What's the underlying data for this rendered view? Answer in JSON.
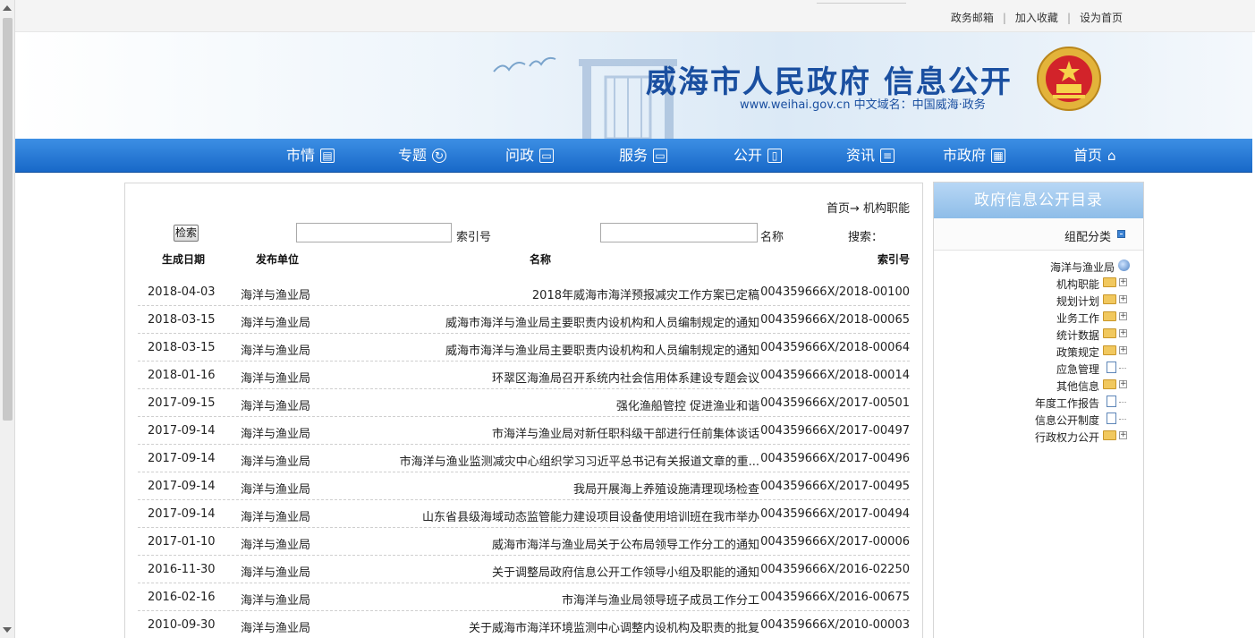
{
  "topbar": {
    "links": [
      "设为首页",
      "加入收藏",
      "政务邮箱"
    ]
  },
  "banner": {
    "title": "威海市人民政府 信息公开",
    "subtitle": "www.weihai.gov.cn 中文域名：中国威海·政务"
  },
  "nav": {
    "items": [
      {
        "label": "首页",
        "icon": "home-icon"
      },
      {
        "label": "市政府",
        "icon": "building-icon"
      },
      {
        "label": "资讯",
        "icon": "news-icon"
      },
      {
        "label": "公开",
        "icon": "book-icon"
      },
      {
        "label": "服务",
        "icon": "monitor-icon"
      },
      {
        "label": "问政",
        "icon": "monitor-icon"
      },
      {
        "label": "专题",
        "icon": "refresh-icon"
      },
      {
        "label": "市情",
        "icon": "document-icon"
      }
    ]
  },
  "main": {
    "breadcrumb": "首页→ 机构职能",
    "search": {
      "label": "搜索：",
      "name_label": "名称",
      "index_label": "索引号",
      "button": "检索"
    },
    "columns": {
      "index": "索引号",
      "name": "名称",
      "unit": "发布单位",
      "date": "生成日期"
    },
    "rows": [
      {
        "index": "004359666X/2018-00100",
        "name": "2018年威海市海洋预报减灾工作方案已定稿",
        "unit": "海洋与渔业局",
        "date": "2018-04-03"
      },
      {
        "index": "004359666X/2018-00065",
        "name": "威海市海洋与渔业局主要职责内设机构和人员编制规定的通知",
        "unit": "海洋与渔业局",
        "date": "2018-03-15"
      },
      {
        "index": "004359666X/2018-00064",
        "name": "威海市海洋与渔业局主要职责内设机构和人员编制规定的通知",
        "unit": "海洋与渔业局",
        "date": "2018-03-15"
      },
      {
        "index": "004359666X/2018-00014",
        "name": "环翠区海渔局召开系统内社会信用体系建设专题会议",
        "unit": "海洋与渔业局",
        "date": "2018-01-16"
      },
      {
        "index": "004359666X/2017-00501",
        "name": "强化渔船管控 促进渔业和谐",
        "unit": "海洋与渔业局",
        "date": "2017-09-15"
      },
      {
        "index": "004359666X/2017-00497",
        "name": "市海洋与渔业局对新任职科级干部进行任前集体谈话",
        "unit": "海洋与渔业局",
        "date": "2017-09-14"
      },
      {
        "index": "004359666X/2017-00496",
        "name": "市海洋与渔业监测减灾中心组织学习习近平总书记有关报道文章的重...",
        "unit": "海洋与渔业局",
        "date": "2017-09-14"
      },
      {
        "index": "004359666X/2017-00495",
        "name": "我局开展海上养殖设施清理现场检查",
        "unit": "海洋与渔业局",
        "date": "2017-09-14"
      },
      {
        "index": "004359666X/2017-00494",
        "name": "山东省县级海域动态监管能力建设项目设备使用培训班在我市举办",
        "unit": "海洋与渔业局",
        "date": "2017-09-14"
      },
      {
        "index": "004359666X/2017-00006",
        "name": "威海市海洋与渔业局关于公布局领导工作分工的通知",
        "unit": "海洋与渔业局",
        "date": "2017-01-10"
      },
      {
        "index": "004359666X/2016-02250",
        "name": "关于调整局政府信息公开工作领导小组及职能的通知",
        "unit": "海洋与渔业局",
        "date": "2016-11-30"
      },
      {
        "index": "004359666X/2016-00675",
        "name": "市海洋与渔业局领导班子成员工作分工",
        "unit": "海洋与渔业局",
        "date": "2016-02-16"
      },
      {
        "index": "004359666X/2010-00003",
        "name": "关于威海市海洋环境监测中心调整内设机构及职责的批复",
        "unit": "海洋与渔业局",
        "date": "2010-09-30"
      }
    ]
  },
  "sidebar": {
    "title": "政府信息公开目录",
    "group": "组配分类",
    "tree": [
      {
        "label": "海洋与渔业局",
        "kind": "root",
        "expand": false
      },
      {
        "label": "机构职能",
        "kind": "folder",
        "expand": true
      },
      {
        "label": "规划计划",
        "kind": "folder",
        "expand": true
      },
      {
        "label": "业务工作",
        "kind": "folder",
        "expand": true
      },
      {
        "label": "统计数据",
        "kind": "folder",
        "expand": true
      },
      {
        "label": "政策规定",
        "kind": "folder",
        "expand": true
      },
      {
        "label": "应急管理",
        "kind": "page",
        "expand": false
      },
      {
        "label": "其他信息",
        "kind": "folder",
        "expand": true
      },
      {
        "label": "年度工作报告",
        "kind": "page",
        "expand": false
      },
      {
        "label": "信息公开制度",
        "kind": "page",
        "expand": false
      },
      {
        "label": "行政权力公开",
        "kind": "folder",
        "expand": true
      }
    ]
  }
}
